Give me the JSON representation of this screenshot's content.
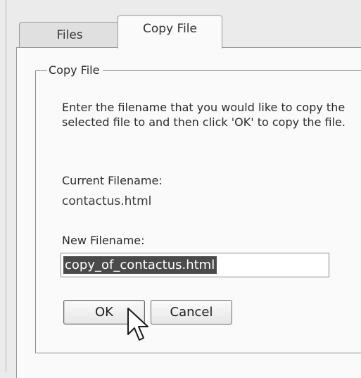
{
  "tabs": [
    {
      "label": "Files",
      "active": false
    },
    {
      "label": "Copy File",
      "active": true
    }
  ],
  "copy_file": {
    "group_label": "Copy File",
    "instructions": "Enter the filename that you would like to copy the selected file to and then click 'OK' to copy the file.",
    "current_filename_label": "Current Filename:",
    "current_filename_value": "contactus.html",
    "new_filename_label": "New Filename:",
    "new_filename_value": "copy_of_contactus.html",
    "ok_label": "OK",
    "cancel_label": "Cancel"
  },
  "icons": {
    "cursor": "mouse-pointer-icon"
  },
  "colors": {
    "page_background": "#ebebeb",
    "tab_page_background": "#fafafa",
    "selection_background": "#4a4a4a",
    "selection_text": "#ffffff"
  }
}
